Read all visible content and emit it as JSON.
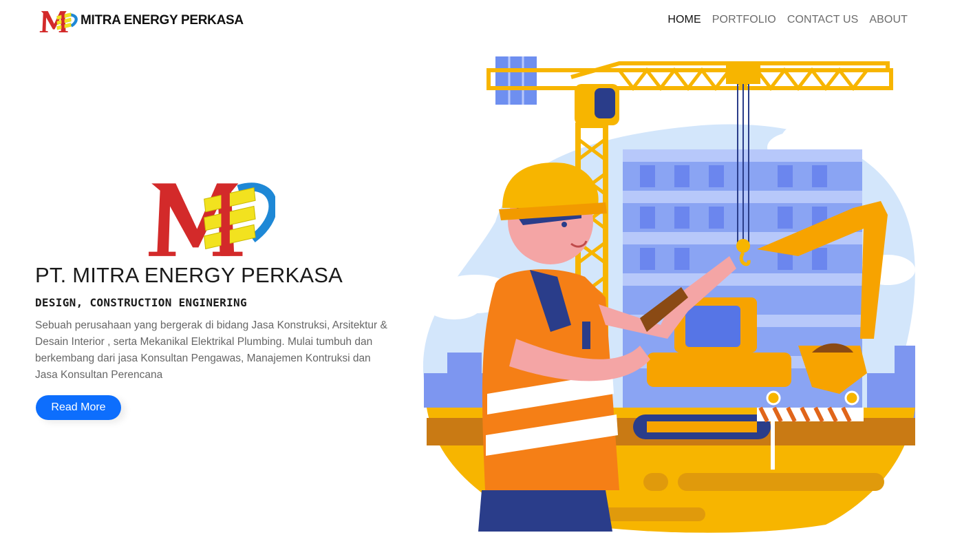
{
  "navbar": {
    "brand_name": "MITRA ENERGY PERKASA",
    "brand_logo_icon": "mep-logo-icon",
    "links": [
      {
        "label": "HOME",
        "active": true
      },
      {
        "label": "PORTFOLIO",
        "active": false
      },
      {
        "label": "CONTACT US",
        "active": false
      },
      {
        "label": "ABOUT",
        "active": false
      }
    ]
  },
  "hero": {
    "logo_icon": "mep-logo-icon",
    "title": "PT. MITRA ENERGY PERKASA",
    "subtitle": "DESIGN, CONSTRUCTION ENGINERING",
    "description": "Sebuah perusahaan yang bergerak di bidang Jasa Konstruksi, Arsitektur & Desain Interior , serta Mekanikal Elektrikal Plumbing. Mulai tumbuh dan berkembang dari jasa Konsultan Pengawas, Manajemen Kontruksi dan Jasa Konsultan Perencana",
    "button_label": "Read More",
    "illustration_icon": "construction-worker-illustration"
  },
  "colors": {
    "primary": "#0d6efd",
    "logo_red": "#d32a2a",
    "logo_yellow": "#f2e21f",
    "logo_blue": "#1e88d6",
    "crane_yellow": "#f7b500",
    "sky_blue": "#d3e6fb",
    "building_blue": "#8aa4f3"
  }
}
